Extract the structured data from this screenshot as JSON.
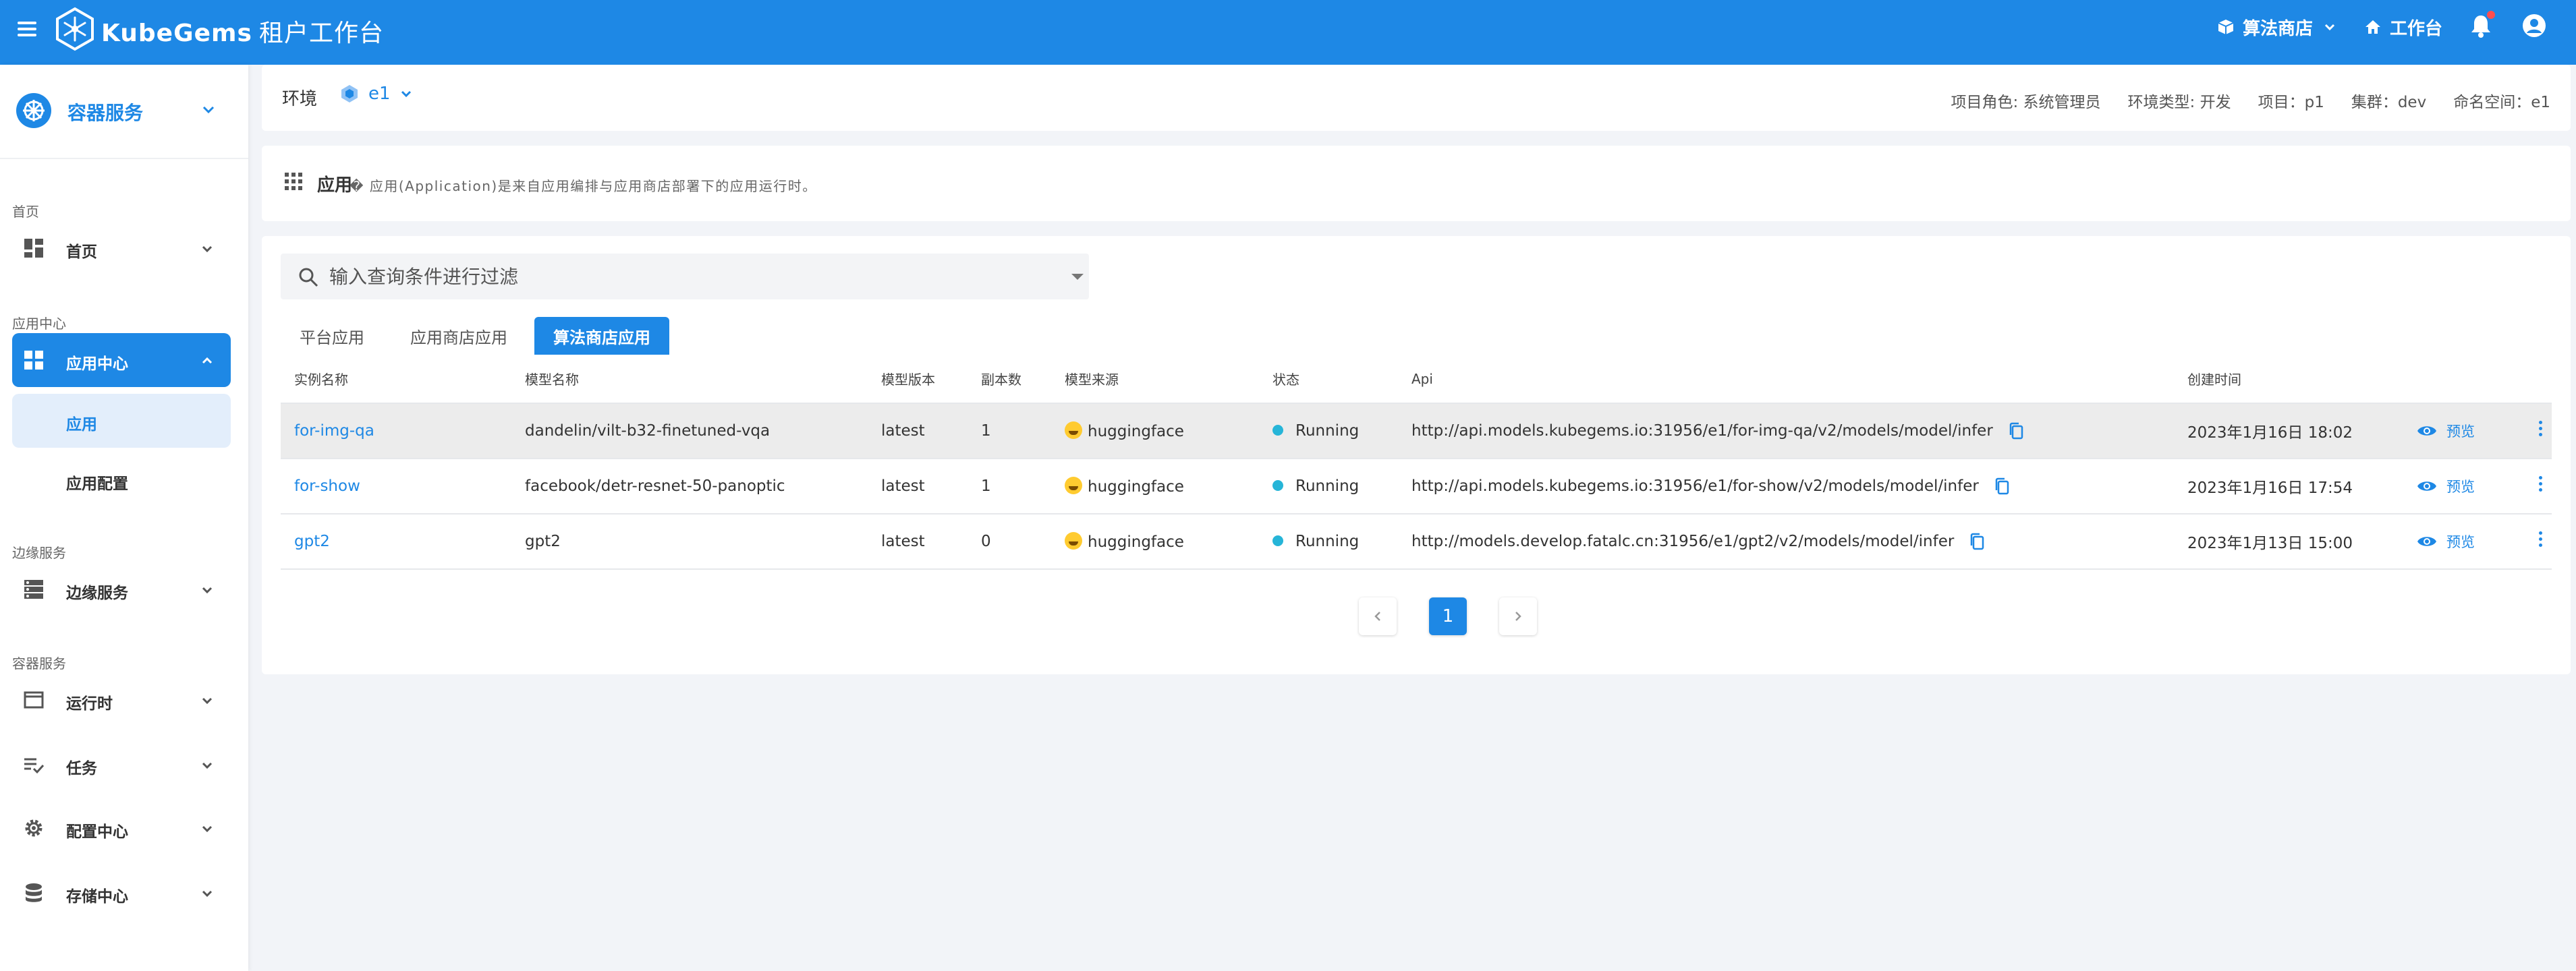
{
  "app": {
    "brand": "KubeGems",
    "subtitle": "租户工作台"
  },
  "topbar": {
    "store_label": "算法商店",
    "workbench_label": "工作台"
  },
  "sidebar": {
    "service_selector": "容器服务",
    "groups": {
      "home": "首页",
      "app_center": "应用中心",
      "edge": "边缘服务",
      "container": "容器服务"
    },
    "items": {
      "home": "首页",
      "app_center": "应用中心",
      "app": "应用",
      "app_config": "应用配置",
      "edge": "边缘服务",
      "runtime": "运行时",
      "task": "任务",
      "config_center": "配置中心",
      "storage_center": "存储中心"
    }
  },
  "env": {
    "label": "环境",
    "value": "e1",
    "meta": {
      "role": "项目角色: 系统管理员",
      "env_type": "环境类型: 开发",
      "project": "项目：p1",
      "cluster": "集群：dev",
      "namespace": "命名空间：e1"
    }
  },
  "app_desc": {
    "title": "应用",
    "text": "� 应用(Application)是来自应用编排与应用商店部署下的应用运行时。"
  },
  "search": {
    "placeholder": "输入查询条件进行过滤"
  },
  "tabs": [
    "平台应用",
    "应用商店应用",
    "算法商店应用"
  ],
  "table": {
    "headers": [
      "实例名称",
      "模型名称",
      "模型版本",
      "副本数",
      "模型来源",
      "状态",
      "Api",
      "创建时间"
    ],
    "action_label": "预览",
    "rows": [
      {
        "instance": "for-img-qa",
        "model": "dandelin/vilt-b32-finetuned-vqa",
        "version": "latest",
        "replicas": "1",
        "source": "huggingface",
        "status": "Running",
        "api": "http://api.models.kubegems.io:31956/e1/for-img-qa/v2/models/model/infer",
        "created": "2023年1月16日 18:02"
      },
      {
        "instance": "for-show",
        "model": "facebook/detr-resnet-50-panoptic",
        "version": "latest",
        "replicas": "1",
        "source": "huggingface",
        "status": "Running",
        "api": "http://api.models.kubegems.io:31956/e1/for-show/v2/models/model/infer",
        "created": "2023年1月16日 17:54"
      },
      {
        "instance": "gpt2",
        "model": "gpt2",
        "version": "latest",
        "replicas": "0",
        "source": "huggingface",
        "status": "Running",
        "api": "http://models.develop.fatalc.cn:31956/e1/gpt2/v2/models/model/infer",
        "created": "2023年1月13日 15:00"
      }
    ]
  },
  "pagination": {
    "current": "1"
  }
}
